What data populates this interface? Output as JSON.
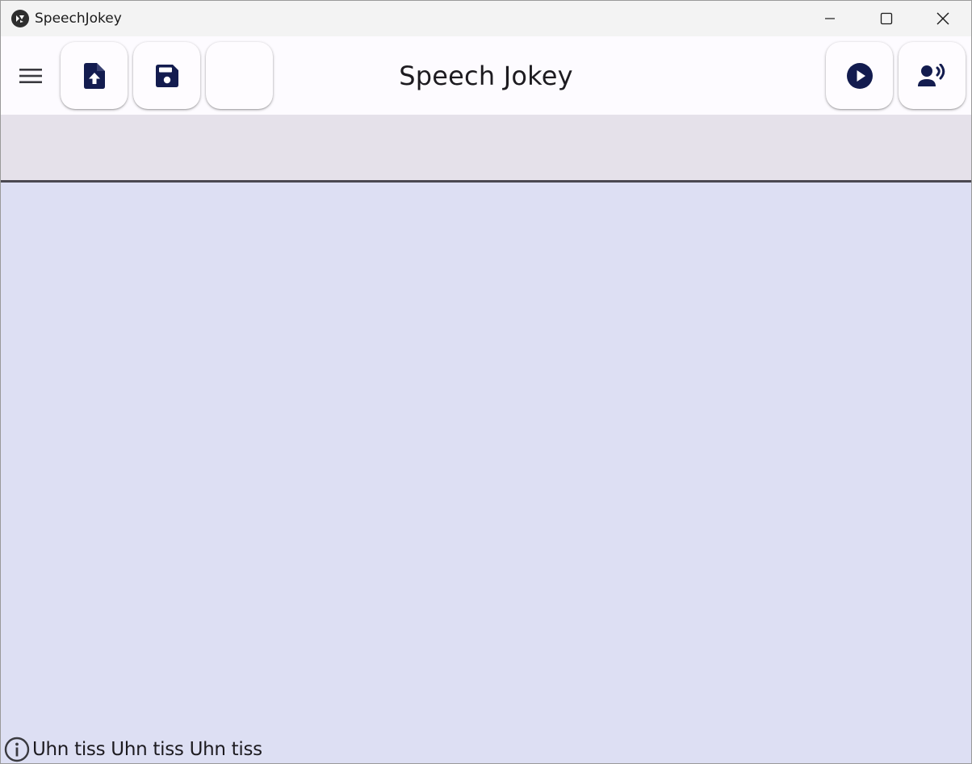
{
  "window": {
    "title": "SpeechJokey"
  },
  "toolbar": {
    "title": "Speech Jokey",
    "buttons": [
      {
        "icon": "menu-icon"
      },
      {
        "icon": "file-upload-icon"
      },
      {
        "icon": "save-icon"
      },
      {
        "icon": ""
      },
      {
        "icon": "play-circle-icon"
      },
      {
        "icon": "record-voice-icon"
      }
    ]
  },
  "status": {
    "icon": "info-icon",
    "text": "Uhn tiss Uhn tiss Uhn tiss"
  },
  "colors": {
    "accent": "#131c4f",
    "toolbar_bg": "#fdfbff",
    "band_bg": "#e5e1ea",
    "main_bg": "#dddff3",
    "divider": "#4a4850"
  }
}
